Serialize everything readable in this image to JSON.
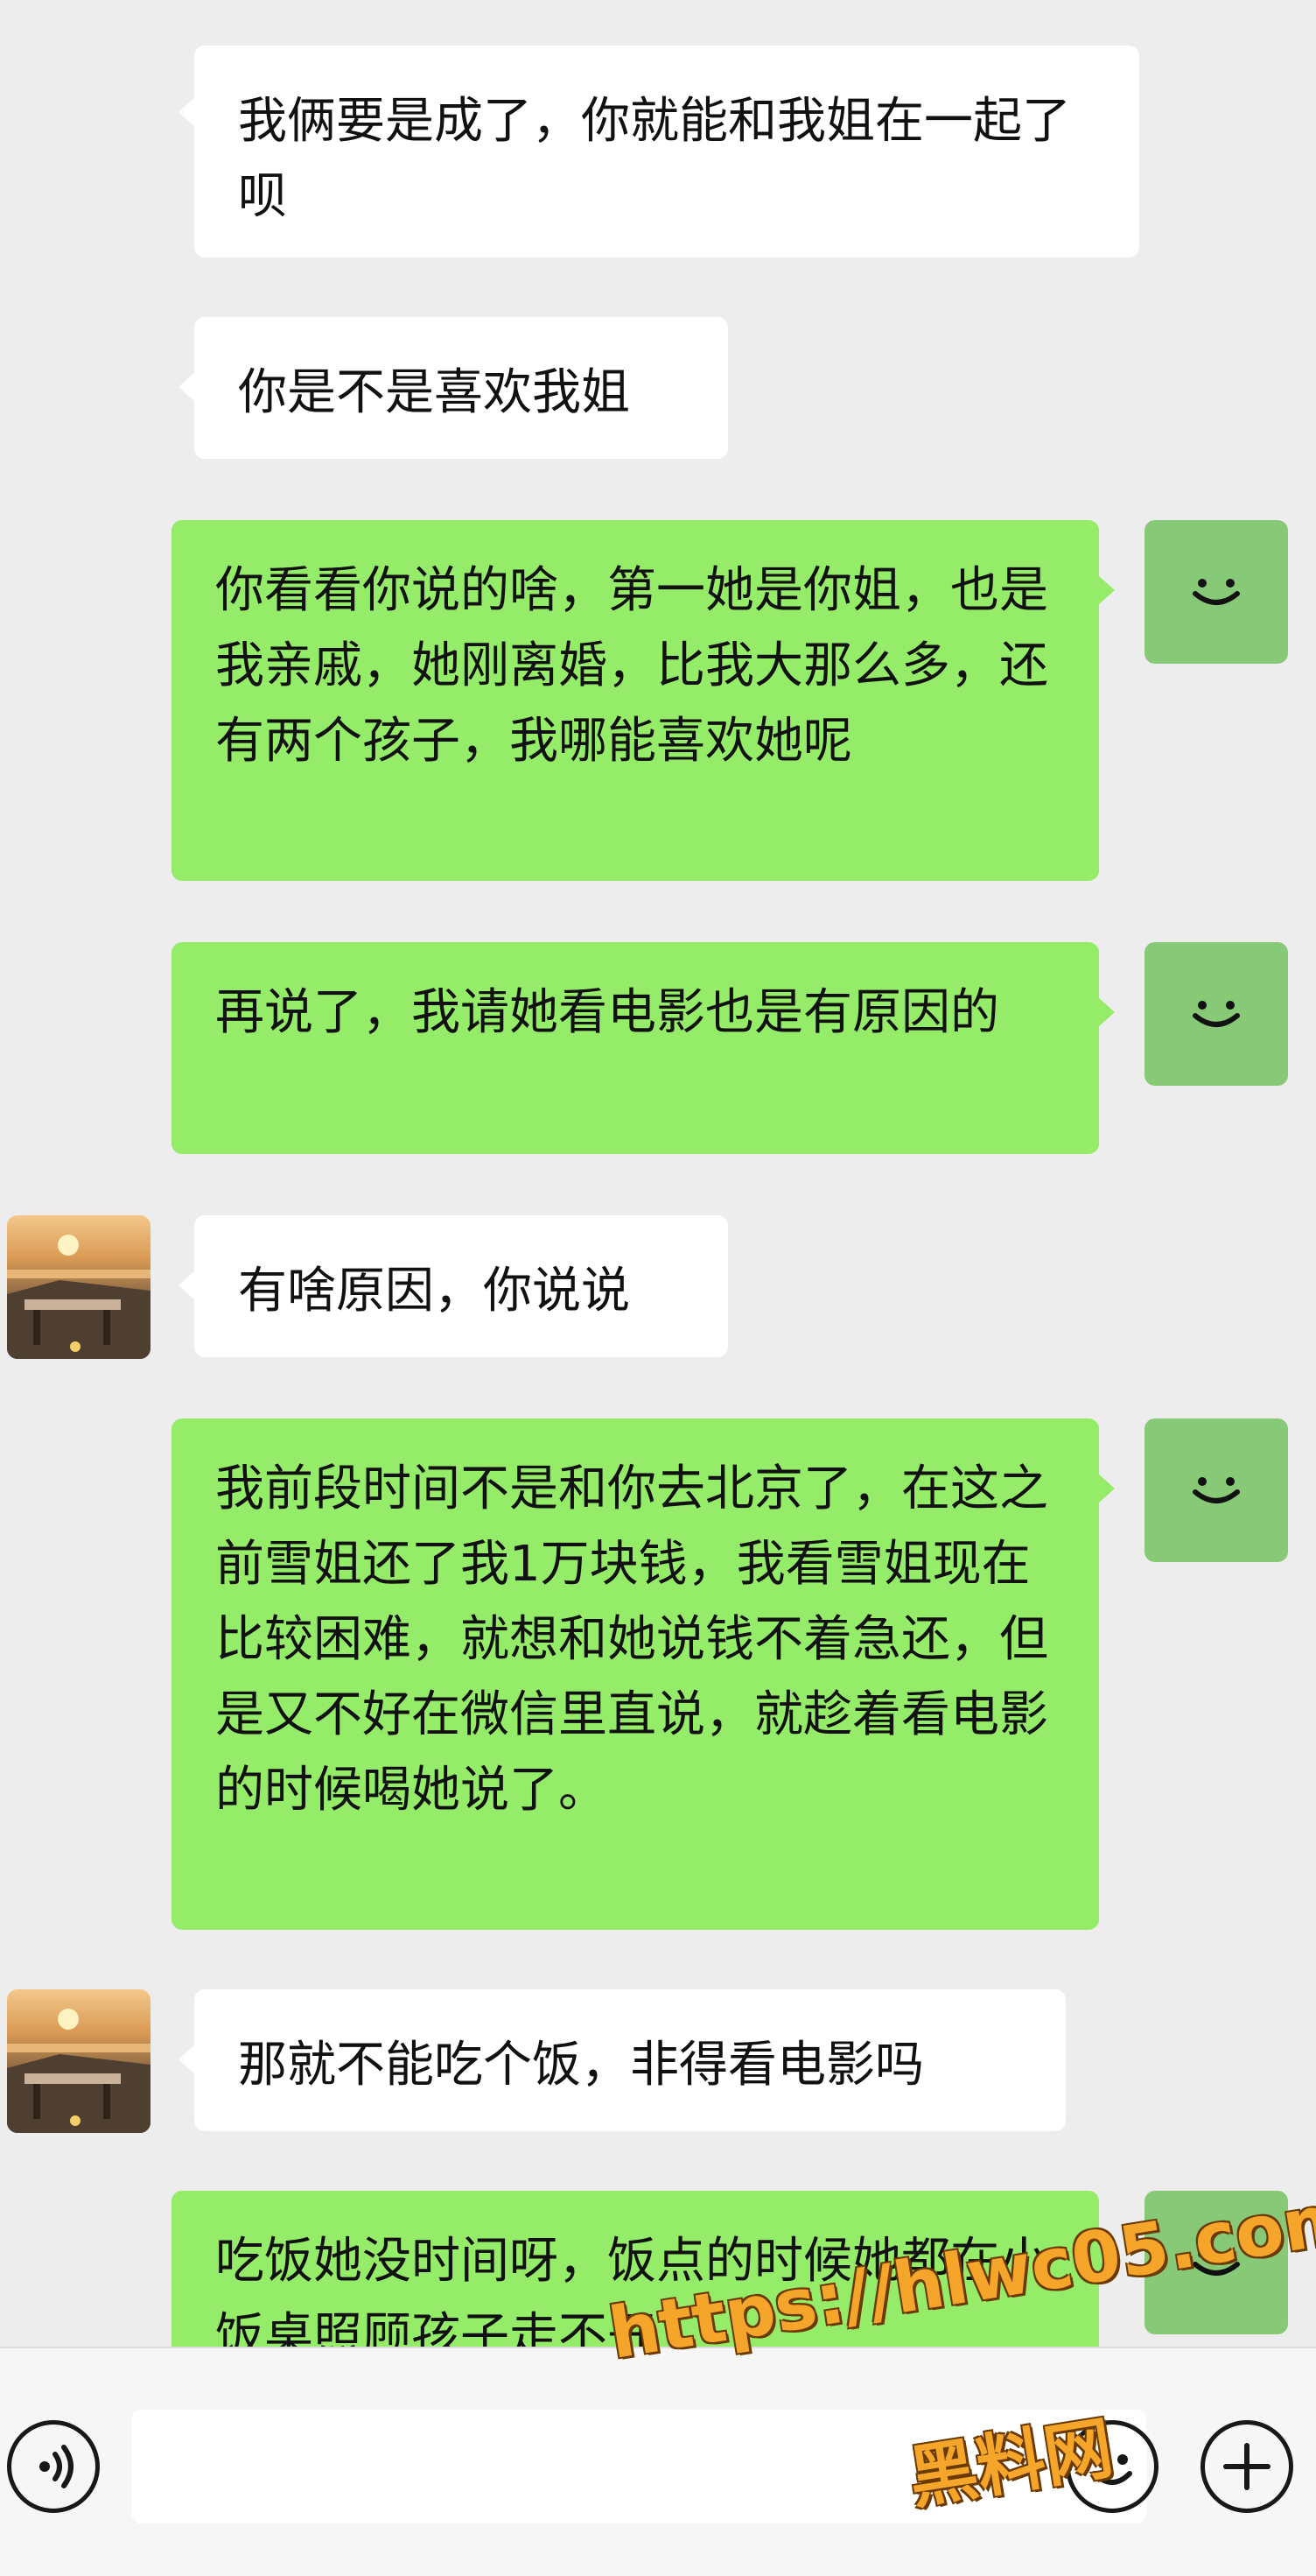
{
  "messages": [
    {
      "side": "in",
      "avatar": false,
      "text": "我俩要是成了，你就能和我姐在一起了呗"
    },
    {
      "side": "in",
      "avatar": false,
      "text": "你是不是喜欢我姐"
    },
    {
      "side": "out",
      "avatar": true,
      "text": "你看看你说的啥，第一她是你姐，也是我亲戚，她刚离婚，比我大那么多，还有两个孩子，我哪能喜欢她呢"
    },
    {
      "side": "out",
      "avatar": true,
      "text": "再说了，我请她看电影也是有原因的"
    },
    {
      "side": "in",
      "avatar": true,
      "text": "有啥原因，你说说"
    },
    {
      "side": "out",
      "avatar": true,
      "text": "我前段时间不是和你去北京了，在这之前雪姐还了我1万块钱，我看雪姐现在比较困难，就想和她说钱不着急还，但是又不好在微信里直说，就趁着看电影的时候喝她说了。"
    },
    {
      "side": "in",
      "avatar": true,
      "text": "那就不能吃个饭，非得看电影吗"
    },
    {
      "side": "out",
      "avatar": true,
      "text": "吃饭她没时间呀，饭点的时候她都在小饭桌照顾孩子走不开"
    }
  ],
  "bottom_bar": {
    "voice_button": "voice-icon",
    "emoji_button": "emoji-icon",
    "plus_button": "plus-icon"
  },
  "watermark": {
    "url": "https://hlwc05.com",
    "name": "黑料网"
  },
  "colors": {
    "background": "#ededed",
    "incoming_bubble": "#ffffff",
    "outgoing_bubble": "#95ec69",
    "avatar_me": "#87c976",
    "watermark": "#f5a52a"
  }
}
